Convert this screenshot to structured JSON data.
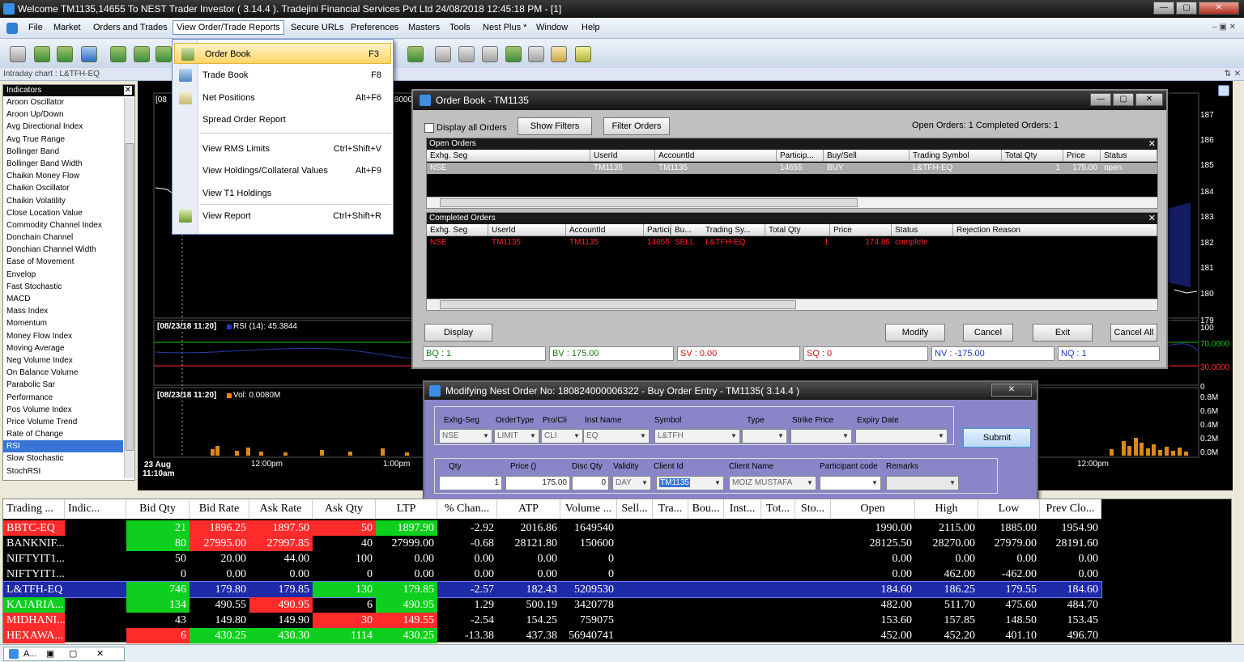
{
  "title_bar": {
    "text": "Welcome TM1135,14655 To NEST Trader Investor ( 3.14.4 ).  Tradejini Financial Services Pvt Ltd  24/08/2018  12:45:18 PM - [1]"
  },
  "menu": {
    "items": [
      "File",
      "Market",
      "Orders and Trades",
      "View Order/Trade Reports",
      "Secure URLs",
      "Preferences",
      "Masters",
      "Tools",
      "Nest Plus *",
      "Window",
      "Help"
    ],
    "active": "View Order/Trade Reports"
  },
  "chart_tab": {
    "label": "Intraday chart : L&TFH-EQ"
  },
  "indicators": {
    "header": "Indicators",
    "items": [
      "Aroon Oscillator",
      "Aroon Up/Down",
      "Avg Directional Index",
      "Avg True Range",
      "Bollinger Band",
      "Bollinger Band Width",
      "Chaikin Money Flow",
      "Chaikin Oscillator",
      "Chaikin Volatility",
      "Close Location Value",
      "Commodity Channel Index",
      "Donchain Channel",
      "Donchian Channel Width",
      "Ease of Movement",
      "Envelop",
      "Fast Stochastic",
      "MACD",
      "Mass Index",
      "Momentum",
      "Money Flow Index",
      "Moving Average",
      "Neg Volume Index",
      "On Balance Volume",
      "Parabolic Sar",
      "Performance",
      "Pos Volume Index",
      "Price Volume Trend",
      "Rate of Change",
      "RSI",
      "Slow Stochastic",
      "StochRSI"
    ],
    "selected": "RSI"
  },
  "chart": {
    "price_axis": [
      "187",
      "186",
      "185",
      "184",
      "183",
      "182",
      "181",
      "180",
      "179"
    ],
    "rsi_axis": [
      "100",
      "70.0000",
      "30.0000",
      "0"
    ],
    "vol_axis": [
      "0.8M",
      "0.6M",
      "0.4M",
      "0.2M",
      "0.0M"
    ],
    "rsi_label": "[08/23/18 11:20]",
    "rsi_value": "RSI (14): 45.3844",
    "vol_label": "[08/23/18 11:20]",
    "vol_value": "Vol: 0.0080M",
    "top_label": "[08",
    "top_value": ".8000",
    "time_axis": [
      "23 Aug",
      "11:10am",
      "12:00pm",
      "1:00pm",
      "12:00pm"
    ],
    "accent_70": "#00cc00",
    "accent_30": "#ff3030"
  },
  "dropdown": {
    "items": [
      {
        "label": "Order Book",
        "key": "F3"
      },
      {
        "label": "Trade Book",
        "key": "F8"
      },
      {
        "label": "Net Positions",
        "key": "Alt+F6"
      },
      {
        "label": "Spread Order Report",
        "key": ""
      },
      {
        "label": "View RMS Limits",
        "key": "Ctrl+Shift+V"
      },
      {
        "label": "View Holdings/Collateral Values",
        "key": "Alt+F9"
      },
      {
        "label": "View T1 Holdings",
        "key": ""
      },
      {
        "label": "View Report",
        "key": "Ctrl+Shift+R"
      }
    ]
  },
  "order_book": {
    "title": "Order Book - TM1135",
    "display_all": "Display all Orders",
    "show_filters": "Show Filters",
    "filter_orders": "Filter Orders",
    "counts": "Open Orders: 1   Completed Orders: 1",
    "open_header": "Open Orders",
    "open_columns": [
      "Exhg. Seg",
      "UserId",
      "AccountId",
      "Particip...",
      "Buy/Sell",
      "Trading Symbol",
      "Total Qty",
      "Price",
      "Status"
    ],
    "open_rows": [
      [
        "NSE",
        "TM1135",
        "TM1135",
        "14655",
        "BUY",
        "L&TFH-EQ",
        "1",
        "175.00",
        "open"
      ]
    ],
    "completed_header": "Completed Orders",
    "completed_columns": [
      "Exhg. Seg",
      "UserId",
      "AccountId",
      "Particip...",
      "Bu...",
      "Trading Sy...",
      "Total Qty",
      "Price",
      "Status",
      "Rejection Reason"
    ],
    "completed_rows": [
      [
        "NSE",
        "TM1135",
        "TM1135",
        "14655",
        "SELL",
        "L&TFH-EQ",
        "1",
        "174.85",
        "complete",
        ""
      ]
    ],
    "buttons": [
      "Display",
      "Modify",
      "Cancel",
      "Exit",
      "Cancel All"
    ],
    "status": [
      "BQ : 1",
      "BV : 175.00",
      "SV : 0.00",
      "SQ : 0",
      "NV : -175.00",
      "NQ : 1"
    ]
  },
  "modify": {
    "title": "Modifying Nest Order No: 180824000006322 - Buy Order Entry - TM1135( 3.14.4 )",
    "labels1": [
      "Exhg-Seg",
      "OrderType",
      "Pro/Cli",
      "Inst Name",
      "Symbol",
      "Type",
      "Strike Price",
      "Expiry Date"
    ],
    "values1": [
      "NSE",
      "LIMIT",
      "CLI",
      "EQ",
      "L&TFH",
      "",
      "",
      ""
    ],
    "labels2": [
      "Qty",
      "Price ()",
      "Disc Qty",
      "Validity",
      "Client Id",
      "Client Name",
      "Participant code",
      "Remarks"
    ],
    "values2": [
      "1",
      "175.00",
      "0",
      "DAY",
      "TM1135",
      "MOIZ MUSTAFA",
      "",
      ""
    ],
    "submit": "Submit"
  },
  "market_watch": {
    "columns": [
      "Trading ...",
      "Indic...",
      "Bid Qty",
      "Bid Rate",
      "Ask Rate",
      "Ask Qty",
      "LTP",
      "% Chan...",
      "ATP",
      "Volume ...",
      "Sell...",
      "Tra...",
      "Bou...",
      "Inst...",
      "Tot...",
      "Sto...",
      "Open",
      "High",
      "Low",
      "Prev Clo..."
    ],
    "rows": [
      {
        "sym": "BBTC-EQ",
        "bidq": "21",
        "bid": "1896.25",
        "ask": "1897.50",
        "askq": "50",
        "ltp": "1897.90",
        "chg": "-2.92",
        "atp": "2016.86",
        "vol": "1649540",
        "open": "1990.00",
        "high": "2115.00",
        "low": "1885.00",
        "prev": "1954.90"
      },
      {
        "sym": "BANKNIF...",
        "bidq": "80",
        "bid": "27995.00",
        "ask": "27997.85",
        "askq": "40",
        "ltp": "27999.00",
        "chg": "-0.68",
        "atp": "28121.80",
        "vol": "150600",
        "open": "28125.50",
        "high": "28270.00",
        "low": "27979.00",
        "prev": "28191.60"
      },
      {
        "sym": "NIFTYIT1...",
        "bidq": "50",
        "bid": "20.00",
        "ask": "44.00",
        "askq": "100",
        "ltp": "0.00",
        "chg": "0.00",
        "atp": "0.00",
        "vol": "0",
        "open": "0.00",
        "high": "0.00",
        "low": "0.00",
        "prev": "0.00"
      },
      {
        "sym": "NIFTYIT1...",
        "bidq": "0",
        "bid": "0.00",
        "ask": "0.00",
        "askq": "0",
        "ltp": "0.00",
        "chg": "0.00",
        "atp": "0.00",
        "vol": "0",
        "open": "0.00",
        "high": "462.00",
        "low": "-462.00",
        "prev": "0.00"
      },
      {
        "sym": "L&TFH-EQ",
        "bidq": "746",
        "bid": "179.80",
        "ask": "179.85",
        "askq": "130",
        "ltp": "179.85",
        "chg": "-2.57",
        "atp": "182.43",
        "vol": "5209530",
        "open": "184.60",
        "high": "186.25",
        "low": "179.55",
        "prev": "184.60"
      },
      {
        "sym": "KAJARIA...",
        "bidq": "134",
        "bid": "490.55",
        "ask": "490.95",
        "askq": "6",
        "ltp": "490.95",
        "chg": "1.29",
        "atp": "500.19",
        "vol": "3420778",
        "open": "482.00",
        "high": "511.70",
        "low": "475.60",
        "prev": "484.70"
      },
      {
        "sym": "MIDHANI...",
        "bidq": "43",
        "bid": "149.80",
        "ask": "149.90",
        "askq": "30",
        "ltp": "149.55",
        "chg": "-2.54",
        "atp": "154.25",
        "vol": "759075",
        "open": "153.60",
        "high": "157.85",
        "low": "148.50",
        "prev": "153.45"
      },
      {
        "sym": "HEXAWA...",
        "bidq": "6",
        "bid": "430.25",
        "ask": "430.30",
        "askq": "1114",
        "ltp": "430.25",
        "chg": "-13.38",
        "atp": "437.38",
        "vol": "56940741",
        "open": "452.00",
        "high": "452.20",
        "low": "401.10",
        "prev": "496.70"
      }
    ]
  },
  "taskbar": {
    "label": "A..."
  }
}
